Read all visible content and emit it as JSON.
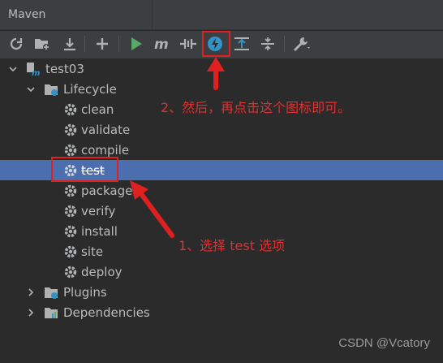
{
  "panel": {
    "title": "Maven"
  },
  "toolbar": {
    "buttons": [
      {
        "name": "reload-icon"
      },
      {
        "name": "add-maven-project-icon"
      },
      {
        "name": "download-sources-icon"
      },
      {
        "name": "plus-icon"
      },
      {
        "name": "run-icon"
      },
      {
        "name": "maven-goal-icon"
      },
      {
        "name": "toggle-offline-icon"
      },
      {
        "name": "skip-tests-icon"
      },
      {
        "name": "show-dependencies-icon"
      },
      {
        "name": "collapse-all-icon"
      },
      {
        "name": "settings-wrench-icon"
      }
    ]
  },
  "tree": {
    "project": "test03",
    "lifecycle_label": "Lifecycle",
    "goals": [
      "clean",
      "validate",
      "compile",
      "test",
      "package",
      "verify",
      "install",
      "site",
      "deploy"
    ],
    "selected_goal": "test",
    "plugins_label": "Plugins",
    "dependencies_label": "Dependencies"
  },
  "annotations": {
    "step2": "2、然后，再点击这个图标即可。",
    "step1": "1、选择 test 选项"
  },
  "watermark": "CSDN @Vcatory",
  "colors": {
    "accent_selected": "#4b6eaf",
    "annotation_red": "#e02020",
    "run_green": "#59a869",
    "skip_tests_blue": "#3592c4"
  }
}
